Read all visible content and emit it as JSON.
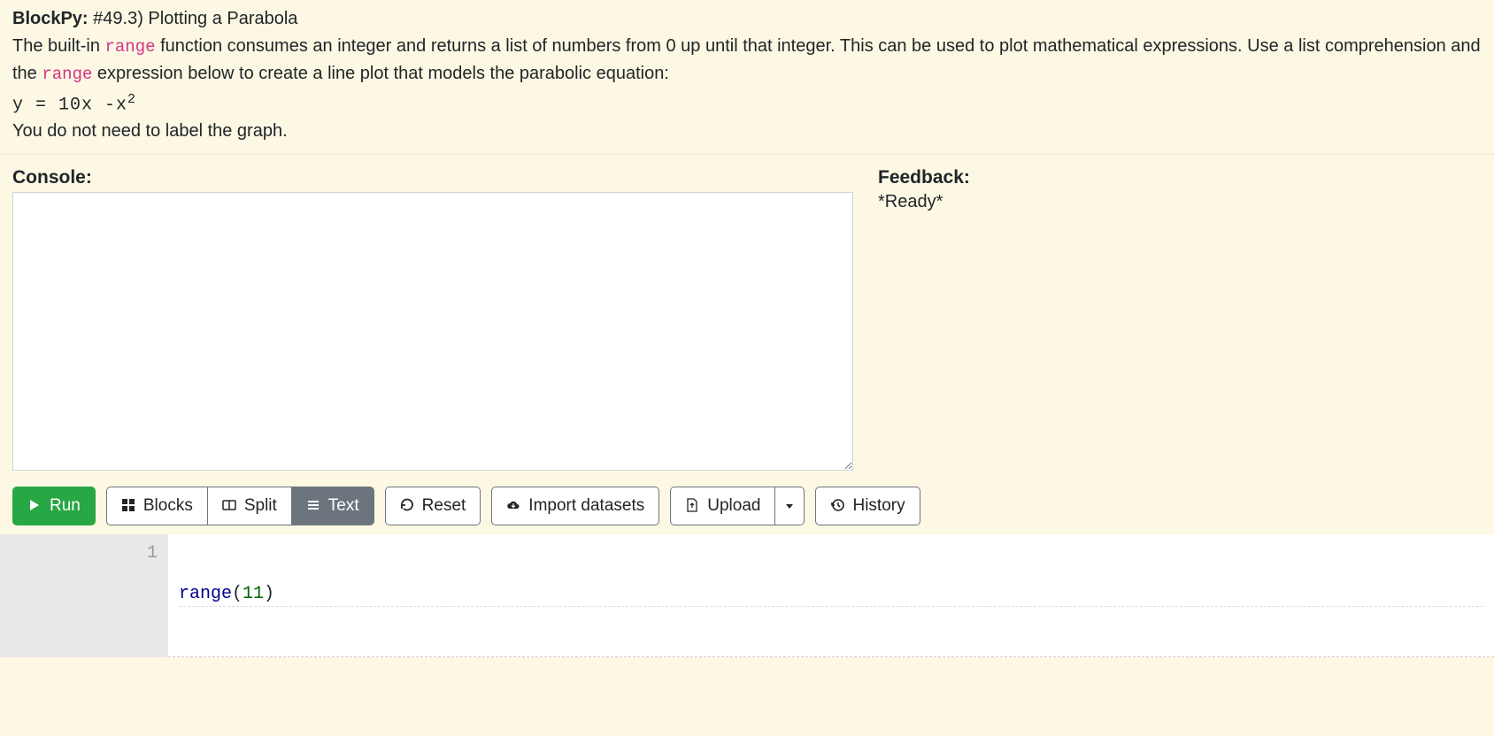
{
  "problem": {
    "app_label": "BlockPy: ",
    "title": "#49.3) Plotting a Parabola",
    "desc_part1": "The built-in ",
    "desc_code1": "range",
    "desc_part2": " function consumes an integer and returns a list of numbers from 0 up until that integer. This can be used to plot mathematical expressions. Use a list comprehension and the ",
    "desc_code2": "range",
    "desc_part3": " expression below to create a line plot that models the parabolic equation:",
    "equation_text": "y = 10x -x",
    "equation_sup": "2",
    "note": "You do not need to label the graph."
  },
  "panels": {
    "console_label": "Console:",
    "feedback_label": "Feedback:",
    "feedback_status": "*Ready*"
  },
  "toolbar": {
    "run": "Run",
    "blocks": "Blocks",
    "split": "Split",
    "text": "Text",
    "reset": "Reset",
    "import_datasets": "Import datasets",
    "upload": "Upload",
    "history": "History"
  },
  "editor": {
    "line_number": "1",
    "code_fn": "range",
    "code_paren_open": "(",
    "code_num": "11",
    "code_paren_close": ")"
  }
}
